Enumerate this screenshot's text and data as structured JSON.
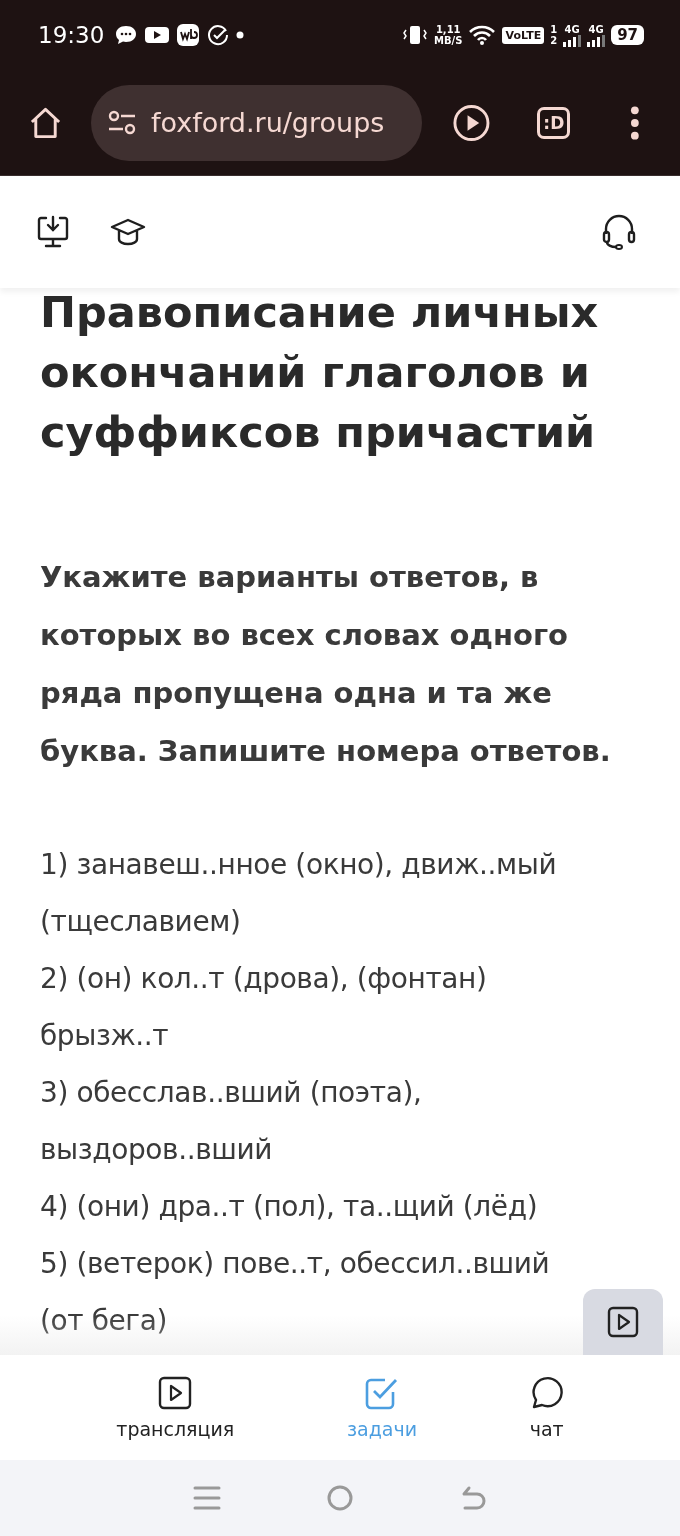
{
  "status_bar": {
    "time": "19:30",
    "speed": "1,11",
    "speed_unit": "MB/S",
    "volte": "VoLTE",
    "sim_1": "1",
    "sim_2": "2",
    "network_1": "4G",
    "network_2": "4G",
    "battery": "97"
  },
  "browser": {
    "url": "foxford.ru/groups",
    "tab_badge": ":D"
  },
  "task": {
    "title": "Правописание личных окончаний глаголов и суффиксов причастий",
    "question": "Укажите варианты ответов, в которых во всех словах одного ряда пропущена одна и та же буква. Запишите номера ответов.",
    "options": [
      "1) занавеш..нное (окно), движ..мый (тщеславием)",
      "2) (он) кол..т (дрова), (фонтан) брызж..т",
      "3) обесслав..вший (поэта), выздоров..вший",
      "4) (они) дра..т (пол), та..щий (лёд)",
      "5) (ветерок) пове..т, обессил..вший (от бега)"
    ]
  },
  "tabs": [
    {
      "label": "трансляция",
      "kind": "video",
      "selected": false
    },
    {
      "label": "задачи",
      "kind": "tasks",
      "selected": true
    },
    {
      "label": "чат",
      "kind": "chat",
      "selected": false
    }
  ]
}
